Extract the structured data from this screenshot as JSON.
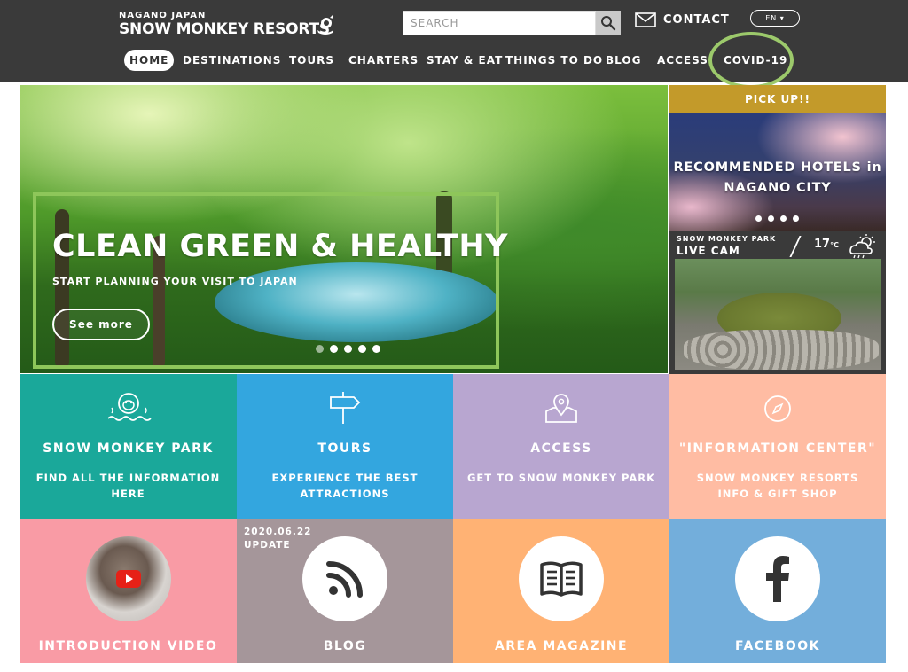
{
  "header": {
    "logo_sub": "NAGANO JAPAN",
    "logo_main": "SNOW MONKEY RESORTS",
    "search_placeholder": "SEARCH",
    "contact_label": "CONTACT",
    "lang_label": "EN ▾"
  },
  "nav": [
    {
      "label": "HOME",
      "active": true
    },
    {
      "label": "DESTINATIONS"
    },
    {
      "label": "TOURS"
    },
    {
      "label": "CHARTERS"
    },
    {
      "label": "STAY & EAT"
    },
    {
      "label": "THINGS TO DO"
    },
    {
      "label": "BLOG"
    },
    {
      "label": "ACCESS"
    },
    {
      "label": "COVID-19"
    }
  ],
  "hero": {
    "title": "CLEAN GREEN & HEALTHY",
    "subtitle": "START PLANNING YOUR VISIT TO JAPAN",
    "button": "See more"
  },
  "pickup": {
    "bar_label": "PICK UP!!",
    "title_line1": "RECOMMENDED HOTELS in",
    "title_line2": "NAGANO CITY"
  },
  "livecam": {
    "sub": "SNOW MONKEY PARK",
    "main": "LIVE CAM",
    "temperature": "17",
    "unit": "°C"
  },
  "tiles": [
    {
      "title": "SNOW MONKEY PARK",
      "desc": "FIND ALL THE INFORMATION HERE",
      "color": "#1aa89a"
    },
    {
      "title": "TOURS",
      "desc": "EXPERIENCE THE BEST ATTRACTIONS",
      "color": "#33a6df"
    },
    {
      "title": "ACCESS",
      "desc": "GET TO SNOW MONKEY PARK",
      "color": "#b8a6d0"
    },
    {
      "title": "\"INFORMATION CENTER\"",
      "desc": "SNOW MONKEY RESORTS INFO & GIFT SHOP",
      "color": "#ffbca3"
    }
  ],
  "bottom_tiles": [
    {
      "label": "INTRODUCTION VIDEO",
      "color": "#f99ba5"
    },
    {
      "label": "BLOG",
      "color": "#a5969a",
      "date": "2020.06.22",
      "update": "UPDATE"
    },
    {
      "label": "AREA MAGAZINE",
      "color": "#ffb274"
    },
    {
      "label": "FACEBOOK",
      "color": "#73aedb"
    }
  ]
}
